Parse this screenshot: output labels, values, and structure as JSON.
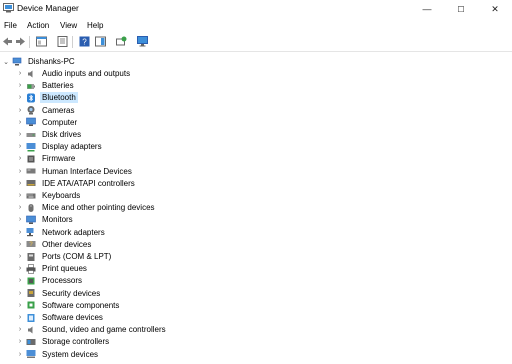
{
  "window": {
    "title": "Device Manager",
    "minimize": "—",
    "maximize": "☐",
    "close": "✕"
  },
  "menu": [
    "File",
    "Action",
    "View",
    "Help"
  ],
  "tree": {
    "root": "Dishanks-PC",
    "items": [
      {
        "label": "Audio inputs and outputs",
        "icon": "speaker-icon"
      },
      {
        "label": "Batteries",
        "icon": "battery-icon"
      },
      {
        "label": "Bluetooth",
        "icon": "bluetooth-icon"
      },
      {
        "label": "Cameras",
        "icon": "camera-icon"
      },
      {
        "label": "Computer",
        "icon": "computer-icon"
      },
      {
        "label": "Disk drives",
        "icon": "disk-icon"
      },
      {
        "label": "Display adapters",
        "icon": "display-adapter-icon"
      },
      {
        "label": "Firmware",
        "icon": "firmware-icon"
      },
      {
        "label": "Human Interface Devices",
        "icon": "hid-icon"
      },
      {
        "label": "IDE ATA/ATAPI controllers",
        "icon": "ide-controller-icon"
      },
      {
        "label": "Keyboards",
        "icon": "keyboard-icon"
      },
      {
        "label": "Mice and other pointing devices",
        "icon": "mouse-icon"
      },
      {
        "label": "Monitors",
        "icon": "monitor-icon"
      },
      {
        "label": "Network adapters",
        "icon": "network-icon"
      },
      {
        "label": "Other devices",
        "icon": "other-device-icon"
      },
      {
        "label": "Ports (COM & LPT)",
        "icon": "port-icon"
      },
      {
        "label": "Print queues",
        "icon": "printer-icon"
      },
      {
        "label": "Processors",
        "icon": "processor-icon"
      },
      {
        "label": "Security devices",
        "icon": "security-icon"
      },
      {
        "label": "Software components",
        "icon": "software-component-icon"
      },
      {
        "label": "Software devices",
        "icon": "software-device-icon"
      },
      {
        "label": "Sound, video and game controllers",
        "icon": "sound-icon"
      },
      {
        "label": "Storage controllers",
        "icon": "storage-icon"
      },
      {
        "label": "System devices",
        "icon": "system-icon"
      }
    ],
    "selected": "Bluetooth"
  },
  "colors": {
    "selection": "#cce8ff",
    "icon_blue": "#2a7fd4"
  }
}
